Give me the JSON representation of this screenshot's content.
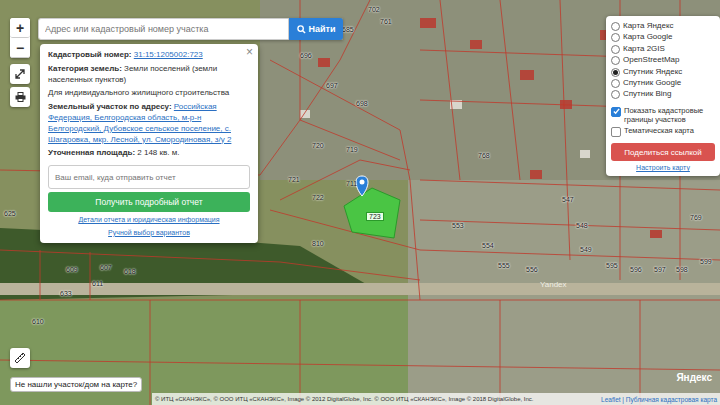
{
  "search": {
    "placeholder": "Адрес или кадастровый номер участка",
    "button": "Найти"
  },
  "zoom": [
    "+",
    "−"
  ],
  "popup": {
    "close": "×",
    "cadastral": {
      "label": "Кадастровый номер:",
      "value": "31:15:1205002:723"
    },
    "category": {
      "label": "Категория земель:",
      "value": "Земли поселений (земли населенных пунктов)"
    },
    "usage": "Для индивидуального жилищного строительства",
    "address": {
      "label": "Земельный участок по адресу:",
      "value": "Российская Федерация, Белгородская область, м-р-н Белгородский, Дубовское сельское поселение, с. Шагаровка, мкр. Лесной, ул. Смородиновая, з/у 2"
    },
    "area": {
      "label": "Уточненная площадь:",
      "value": "2 148 кв. м."
    },
    "email_placeholder": "Ваш email, куда отправить отчет",
    "report_button": "Получить подробный отчет",
    "links": [
      "Детали отчета и юридическая информация",
      "Ручной выбор вариантов"
    ]
  },
  "layers": [
    {
      "label": "Карта Яндекс",
      "selected": false
    },
    {
      "label": "Карта Google",
      "selected": false
    },
    {
      "label": "Карта 2GIS",
      "selected": false
    },
    {
      "label": "OpenStreetMap",
      "selected": false
    },
    {
      "label": "Спутник Яндекс",
      "selected": true
    },
    {
      "label": "Спутник Google",
      "selected": false
    },
    {
      "label": "Спутник Bing",
      "selected": false
    }
  ],
  "options": [
    {
      "label": "Показать кадастровые границы участков",
      "checked": true
    },
    {
      "label": "Тематическая карта",
      "checked": false
    }
  ],
  "share_button": "Поделиться ссылкой",
  "settings_link": "Настроить карту",
  "parcels": [
    {
      "label": "702",
      "selected": false
    },
    {
      "label": "761",
      "selected": false
    },
    {
      "label": "685",
      "selected": false
    },
    {
      "label": "696",
      "selected": false
    },
    {
      "label": "697",
      "selected": false
    },
    {
      "label": "698",
      "selected": false
    },
    {
      "label": "720",
      "selected": false
    },
    {
      "label": "719",
      "selected": false
    },
    {
      "label": "721",
      "selected": false
    },
    {
      "label": "722",
      "selected": false
    },
    {
      "label": "711",
      "selected": false
    },
    {
      "label": "723",
      "selected": true
    },
    {
      "label": "768",
      "selected": false
    },
    {
      "label": "810",
      "selected": false
    },
    {
      "label": "625",
      "selected": false
    },
    {
      "label": "609",
      "selected": false
    },
    {
      "label": "607",
      "selected": false
    },
    {
      "label": "611",
      "selected": false
    },
    {
      "label": "618",
      "selected": false
    },
    {
      "label": "633",
      "selected": false
    },
    {
      "label": "610",
      "selected": false
    },
    {
      "label": "553",
      "selected": false
    },
    {
      "label": "554",
      "selected": false
    },
    {
      "label": "555",
      "selected": false
    },
    {
      "label": "556",
      "selected": false
    },
    {
      "label": "547",
      "selected": false
    },
    {
      "label": "548",
      "selected": false
    },
    {
      "label": "549",
      "selected": false
    },
    {
      "label": "595",
      "selected": false
    },
    {
      "label": "596",
      "selected": false
    },
    {
      "label": "597",
      "selected": false
    },
    {
      "label": "598",
      "selected": false
    },
    {
      "label": "599",
      "selected": false
    },
    {
      "label": "769",
      "selected": false
    }
  ],
  "watermark": "Yandex",
  "not_found_button": "Не нашли участок/дом на карте?",
  "attribution": "© ИТЦ «СКАНЭКС», © ООО ИТЦ «СКАНЭКС», Image © 2012 DigitalGlobe, Inc. © ООО ИТЦ «СКАНЭКС», Image © 2018 DigitalGlobe, Inc.",
  "leaflet": "Leaflet | Публичная кадастровая карта",
  "logo": "Яндекс"
}
